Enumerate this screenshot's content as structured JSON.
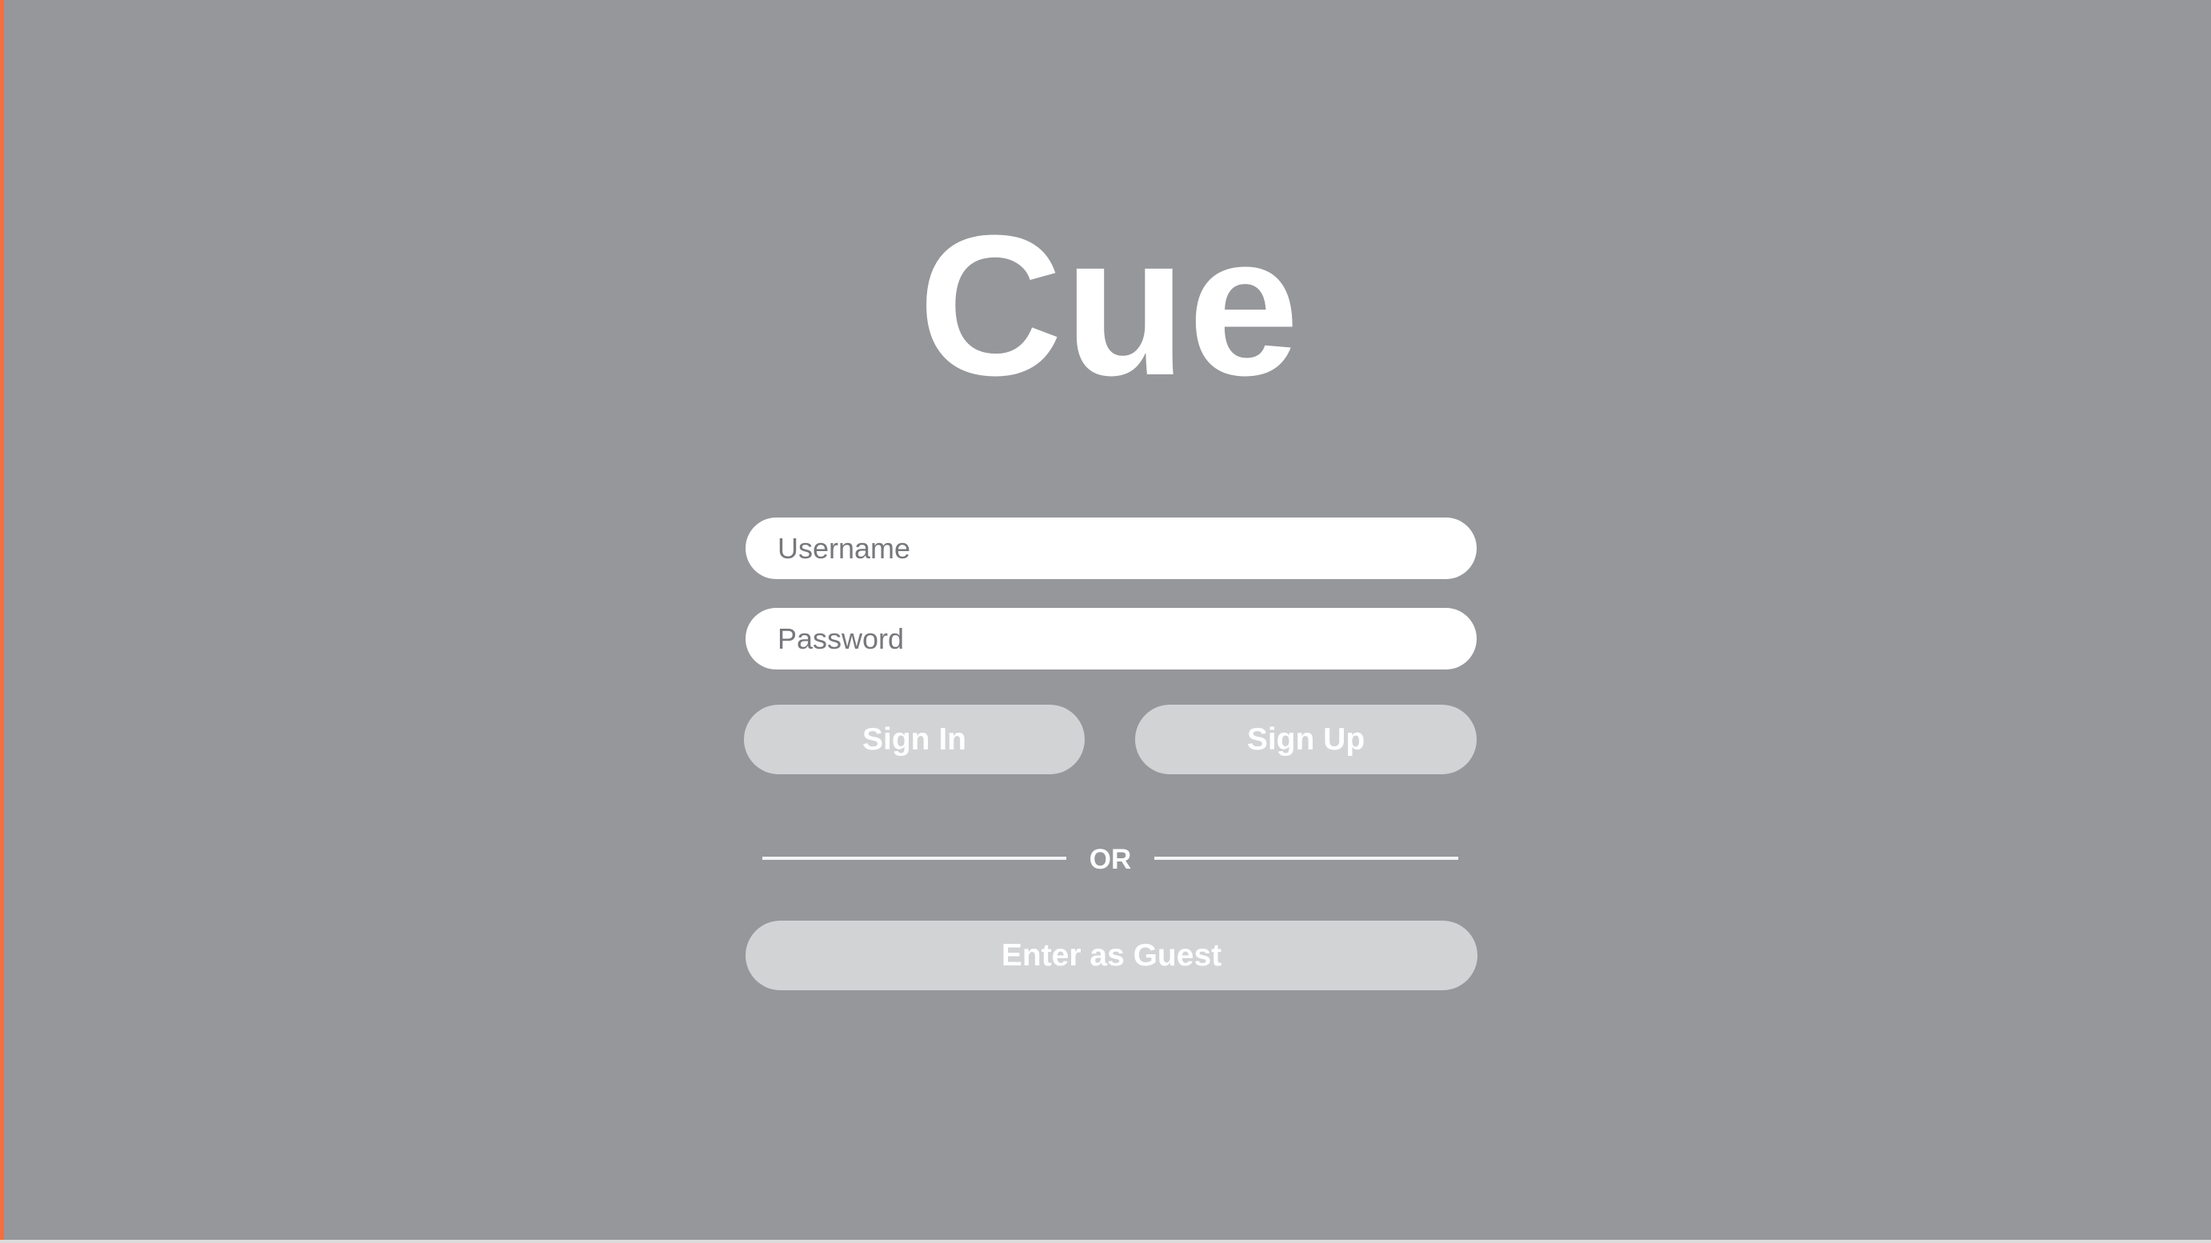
{
  "app": {
    "title": "Cue"
  },
  "form": {
    "username_placeholder": "Username",
    "username_value": "",
    "password_placeholder": "Password",
    "password_value": "",
    "sign_in_label": "Sign In",
    "sign_up_label": "Sign Up",
    "divider_label": "OR",
    "guest_label": "Enter as Guest"
  },
  "colors": {
    "background": "#96979b",
    "button": "#d2d3d5",
    "input": "#ffffff",
    "accent_border": "#f0703f"
  }
}
